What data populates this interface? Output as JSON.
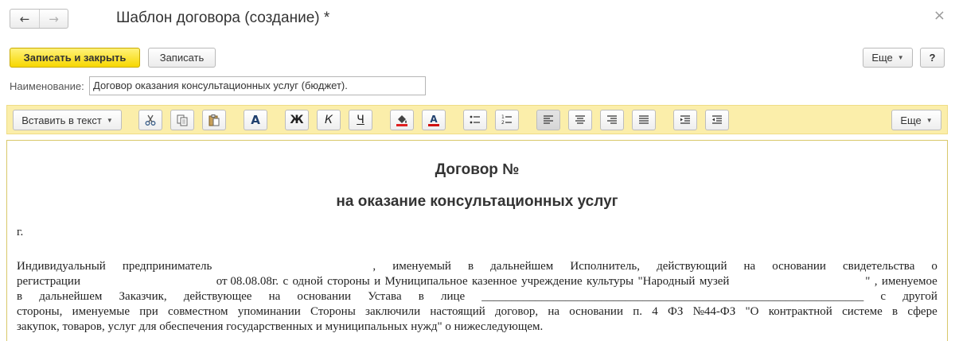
{
  "window": {
    "title": "Шаблон договора (создание) *",
    "back_icon": "←",
    "forward_icon": "→",
    "close_icon": "×"
  },
  "commands": {
    "save_close": "Записать и закрыть",
    "save": "Записать",
    "more": "Еще",
    "help": "?"
  },
  "name_field": {
    "label": "Наименование:",
    "value": "Договор оказания консультационных услуг (бюджет)."
  },
  "format_toolbar": {
    "insert_label": "Вставить в текст",
    "more": "Еще",
    "font_icon": "A",
    "bold": "Ж",
    "italic": "К",
    "underline": "Ч",
    "font_color_icon": "A",
    "highlight_color": "#e02020",
    "font_color": "#d01010",
    "active_alignment": "left"
  },
  "document": {
    "title": "Договор №",
    "subtitle": "на оказание консультационных услуг",
    "city": "г.",
    "lines": [
      [
        "Индивидуальный",
        "предприниматель",
        "",
        ",",
        "именуемый",
        "в",
        "дальнейшем",
        "Исполнитель,",
        "действующий",
        "на",
        "основании",
        "свидетельства",
        "о"
      ],
      [
        "регистрации",
        "",
        "от 08.08.08г.",
        "с",
        "одной",
        "стороны",
        "и",
        "Муниципальное",
        "казенное",
        "учреждение",
        "культуры",
        "\"Народный",
        "музей",
        "",
        "\"",
        ",",
        "именуемое"
      ],
      [
        "в",
        "дальнейшем",
        "Заказчик,",
        "действующее",
        "на",
        "основании",
        "Устава",
        "в",
        "лице",
        "________________________________________________________________",
        "с",
        "другой"
      ],
      [
        "стороны,",
        "именуемые",
        "при",
        "совместном",
        "упоминании",
        "Стороны",
        "заключили",
        "настоящий",
        "договор,",
        "на",
        "основании",
        "п.",
        "4",
        "ФЗ",
        "№44-ФЗ",
        "\"О",
        "контрактной",
        "системе",
        "в",
        "сфере"
      ],
      [
        "закупок, товаров, услуг для обеспечения государственных и муниципальных нужд\" о нижеследующем."
      ]
    ]
  }
}
